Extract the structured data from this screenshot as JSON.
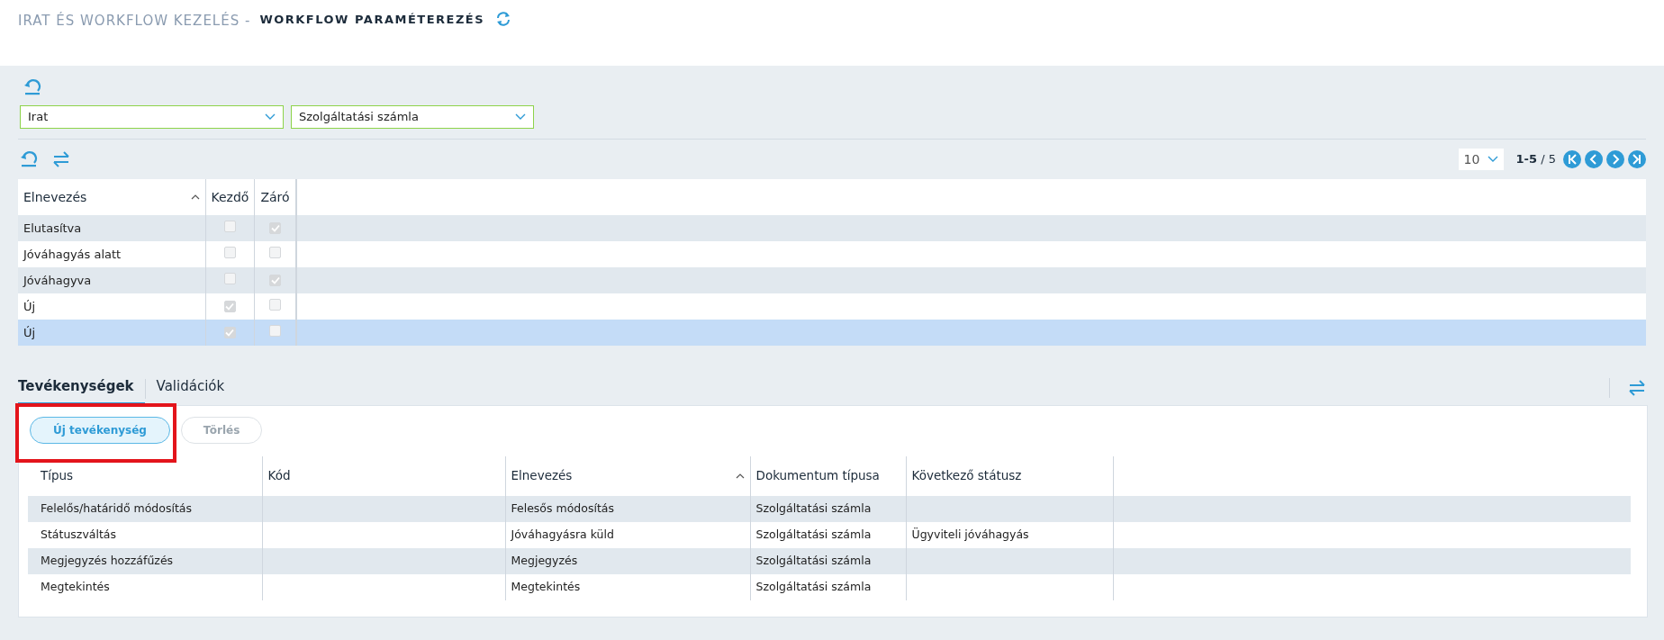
{
  "header": {
    "module": "IRAT ÉS WORKFLOW KEZELÉS -",
    "page": "WORKFLOW PARAMÉTEREZÉS"
  },
  "filters": [
    {
      "value": "Irat"
    },
    {
      "value": "Szolgáltatási számla"
    }
  ],
  "pager": {
    "page_size": "10",
    "range": "1-5",
    "total": "/ 5"
  },
  "status_table": {
    "columns": [
      {
        "label": "Elnevezés",
        "sorted": true
      },
      {
        "label": "Kezdő",
        "sorted": false
      },
      {
        "label": "Záró",
        "sorted": false
      }
    ],
    "rows": [
      {
        "name": "Elutasítva",
        "start": false,
        "end": true,
        "selected": false
      },
      {
        "name": "Jóváhagyás alatt",
        "start": false,
        "end": false,
        "selected": false
      },
      {
        "name": "Jóváhagyva",
        "start": false,
        "end": true,
        "selected": false
      },
      {
        "name": "Új",
        "start": true,
        "end": false,
        "selected": false
      },
      {
        "name": "Új",
        "start": true,
        "end": false,
        "selected": true
      }
    ]
  },
  "tabs": [
    {
      "label": "Tevékenységek",
      "selected": true
    },
    {
      "label": "Validációk",
      "selected": false
    }
  ],
  "buttons": [
    {
      "label": "Új tevékenység",
      "disabled": false
    },
    {
      "label": "Törlés",
      "disabled": true
    }
  ],
  "activity_table": {
    "columns": [
      {
        "label": "Típus",
        "sorted": false
      },
      {
        "label": "Kód",
        "sorted": false
      },
      {
        "label": "Elnevezés",
        "sorted": true
      },
      {
        "label": "Dokumentum típusa",
        "sorted": false
      },
      {
        "label": "Következő státusz",
        "sorted": false
      }
    ],
    "rows": [
      [
        "Felelős/határidő módosítás",
        "",
        "Felesős módosítás",
        "Szolgáltatási számla",
        ""
      ],
      [
        "Státuszváltás",
        "",
        "Jóváhagyásra küld",
        "Szolgáltatási számla",
        "Ügyviteli jóváhagyás"
      ],
      [
        "Megjegyzés hozzáfűzés",
        "",
        "Megjegyzés",
        "Szolgáltatási számla",
        ""
      ],
      [
        "Megtekintés",
        "",
        "Megtekintés",
        "Szolgáltatási számla",
        ""
      ]
    ]
  }
}
